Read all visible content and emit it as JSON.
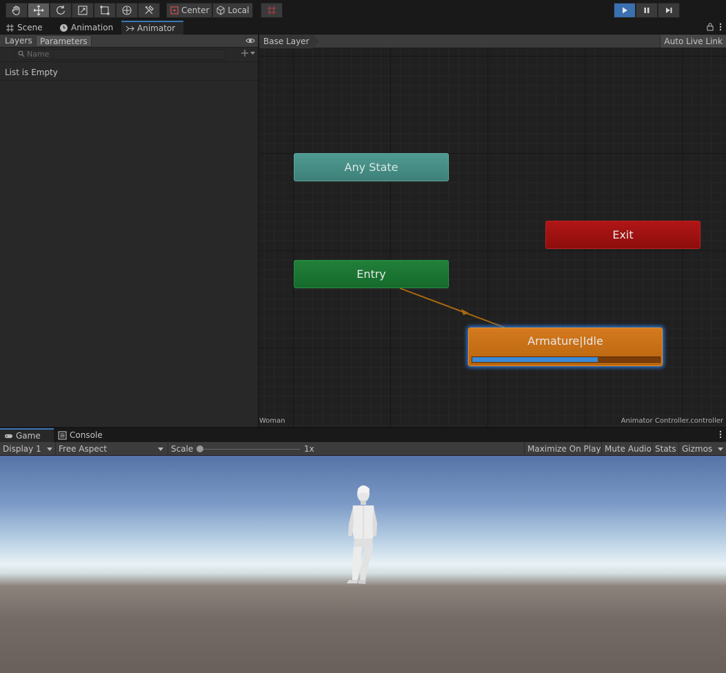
{
  "toolbar": {
    "tools": [
      "hand-icon",
      "move-icon",
      "rotate-icon",
      "scale-icon",
      "rect-icon",
      "transform-icon",
      "custom-tools-icon"
    ],
    "pivot_label": "Center",
    "space_label": "Local",
    "playback": [
      "play-icon",
      "pause-icon",
      "step-icon"
    ]
  },
  "tabs": {
    "scene": "Scene",
    "animation": "Animation",
    "animator": "Animator"
  },
  "animator": {
    "layers_tab": "Layers",
    "parameters_tab": "Parameters",
    "search_placeholder": "Name",
    "empty_text": "List is Empty",
    "breadcrumb": "Base Layer",
    "auto_live_link": "Auto Live Link",
    "footer_left": "Woman",
    "footer_right": "Animator Controller.controller",
    "nodes": {
      "any_state": "Any State",
      "entry": "Entry",
      "exit": "Exit",
      "idle": "Armature|Idle"
    },
    "idle_progress": 0.67
  },
  "game": {
    "tab_game": "Game",
    "tab_console": "Console",
    "display": "Display 1",
    "aspect": "Free Aspect",
    "scale_label": "Scale",
    "scale_value": "1x",
    "maximize": "Maximize On Play",
    "mute": "Mute Audio",
    "stats": "Stats",
    "gizmos": "Gizmos"
  },
  "colors": {
    "accent": "#3a79bb",
    "any_state": "#4f9a92",
    "entry": "#21803a",
    "exit": "#b01616",
    "idle": "#d47a1f",
    "progress": "#3a8ad6"
  }
}
